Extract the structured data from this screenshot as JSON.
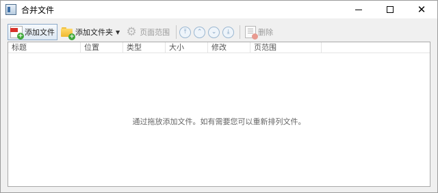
{
  "window": {
    "title": "合并文件",
    "icon": "app-window-icon"
  },
  "toolbar": {
    "add_file_label": "添加文件",
    "add_folder_label": "添加文件夹",
    "page_range_label": "页面范围",
    "delete_label": "删除",
    "move_buttons": [
      {
        "icon": "move-top-icon",
        "glyph": "⤒"
      },
      {
        "icon": "move-up-icon",
        "glyph": "⌃"
      },
      {
        "icon": "move-down-icon",
        "glyph": "⌄"
      },
      {
        "icon": "move-bottom-icon",
        "glyph": "⤓"
      }
    ]
  },
  "list": {
    "columns": [
      "标题",
      "位置",
      "类型",
      "大小",
      "修改",
      "页范围"
    ],
    "empty_hint": "通过拖放添加文件。如有需要您可以重新排列文件。"
  },
  "colors": {
    "accent": "#3fa83a",
    "pdf_red": "#d8322a",
    "folder_yellow": "#f0b830"
  }
}
